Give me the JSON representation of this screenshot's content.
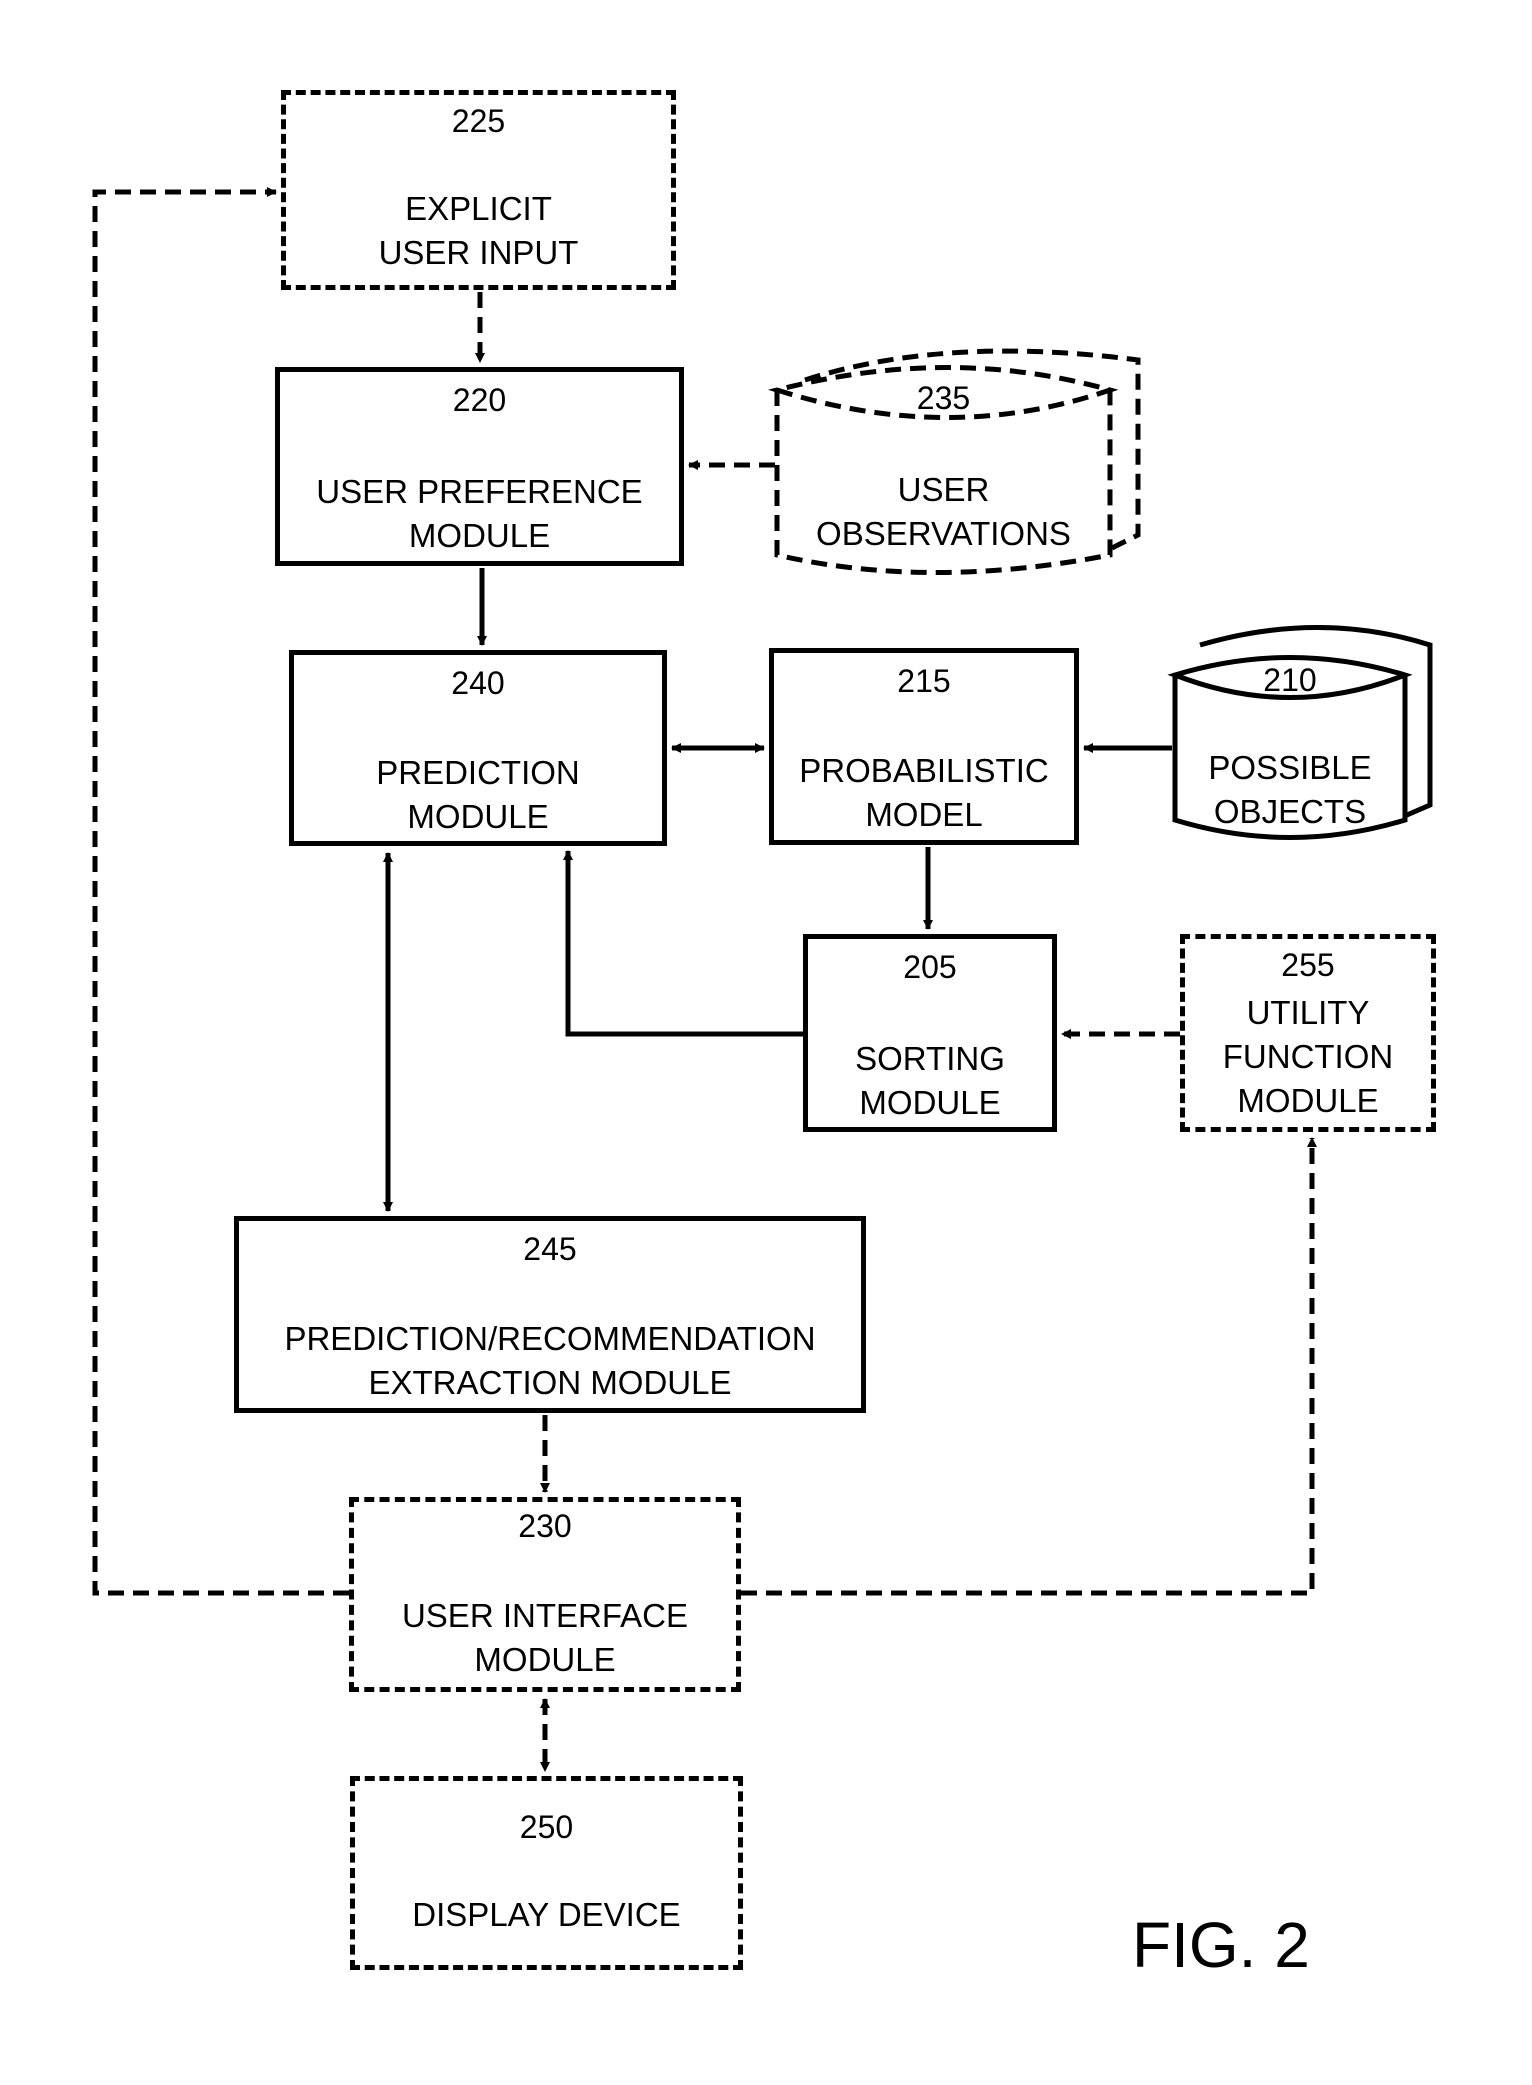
{
  "figure_label": "FIG. 2",
  "nodes": {
    "n225": {
      "number": "225",
      "line1": "EXPLICIT",
      "line2": "USER INPUT",
      "style": "dashed"
    },
    "n220": {
      "number": "220",
      "line1": "USER PREFERENCE",
      "line2": "MODULE",
      "style": "solid"
    },
    "n235": {
      "number": "235",
      "line1": "USER",
      "line2": "OBSERVATIONS",
      "style": "dashed-cylinder"
    },
    "n240": {
      "number": "240",
      "line1": "PREDICTION",
      "line2": "MODULE",
      "style": "solid"
    },
    "n215": {
      "number": "215",
      "line1": "PROBABILISTIC",
      "line2": "MODEL",
      "style": "solid"
    },
    "n210": {
      "number": "210",
      "line1": "POSSIBLE",
      "line2": "OBJECTS",
      "style": "solid-cylinder"
    },
    "n205": {
      "number": "205",
      "line1": "SORTING",
      "line2": "MODULE",
      "style": "solid"
    },
    "n255": {
      "number": "255",
      "line1": "UTILITY",
      "line2": "FUNCTION",
      "line3": "MODULE",
      "style": "dashed"
    },
    "n245": {
      "number": "245",
      "line1": "PREDICTION/RECOMMENDATION",
      "line2": "EXTRACTION MODULE",
      "style": "solid"
    },
    "n230": {
      "number": "230",
      "line1": "USER INTERFACE",
      "line2": "MODULE",
      "style": "dashed"
    },
    "n250": {
      "number": "250",
      "line1": "DISPLAY DEVICE",
      "style": "dashed"
    }
  },
  "edges": [
    {
      "from": "225",
      "to": "220",
      "style": "dashed",
      "direction": "forward"
    },
    {
      "from": "235",
      "to": "220",
      "style": "dashed",
      "direction": "forward"
    },
    {
      "from": "220",
      "to": "240",
      "style": "solid",
      "direction": "forward"
    },
    {
      "from": "240",
      "to": "215",
      "style": "solid",
      "direction": "both"
    },
    {
      "from": "210",
      "to": "215",
      "style": "solid",
      "direction": "forward"
    },
    {
      "from": "215",
      "to": "205",
      "style": "solid",
      "direction": "forward"
    },
    {
      "from": "205",
      "to": "240",
      "style": "solid",
      "direction": "forward"
    },
    {
      "from": "255",
      "to": "205",
      "style": "dashed",
      "direction": "forward"
    },
    {
      "from": "240",
      "to": "245",
      "style": "solid",
      "direction": "both"
    },
    {
      "from": "245",
      "to": "230",
      "style": "dashed",
      "direction": "forward"
    },
    {
      "from": "230",
      "to": "250",
      "style": "dashed",
      "direction": "both"
    },
    {
      "from": "230",
      "to": "225",
      "style": "dashed",
      "direction": "forward"
    },
    {
      "from": "230",
      "to": "255",
      "style": "dashed",
      "direction": "forward"
    }
  ]
}
